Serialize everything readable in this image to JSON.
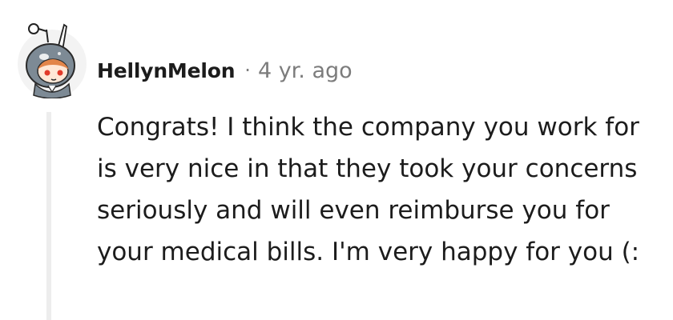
{
  "comment": {
    "author": "HellynMelon",
    "separator": "·",
    "age": "4 yr. ago",
    "body": "Congrats! I think the company you work for is very nice in that they took your concerns seriously and will even reimburse you for your medical bills. I'm very happy for you (:",
    "avatar_icon": "narwhal-snoo-avatar-icon"
  },
  "colors": {
    "text": "#1c1c1c",
    "meta": "#7c7c7c",
    "thread_line": "#ededed",
    "avatar_bg": "#f3f3f3",
    "avatar_hood": "#7d8a95"
  }
}
